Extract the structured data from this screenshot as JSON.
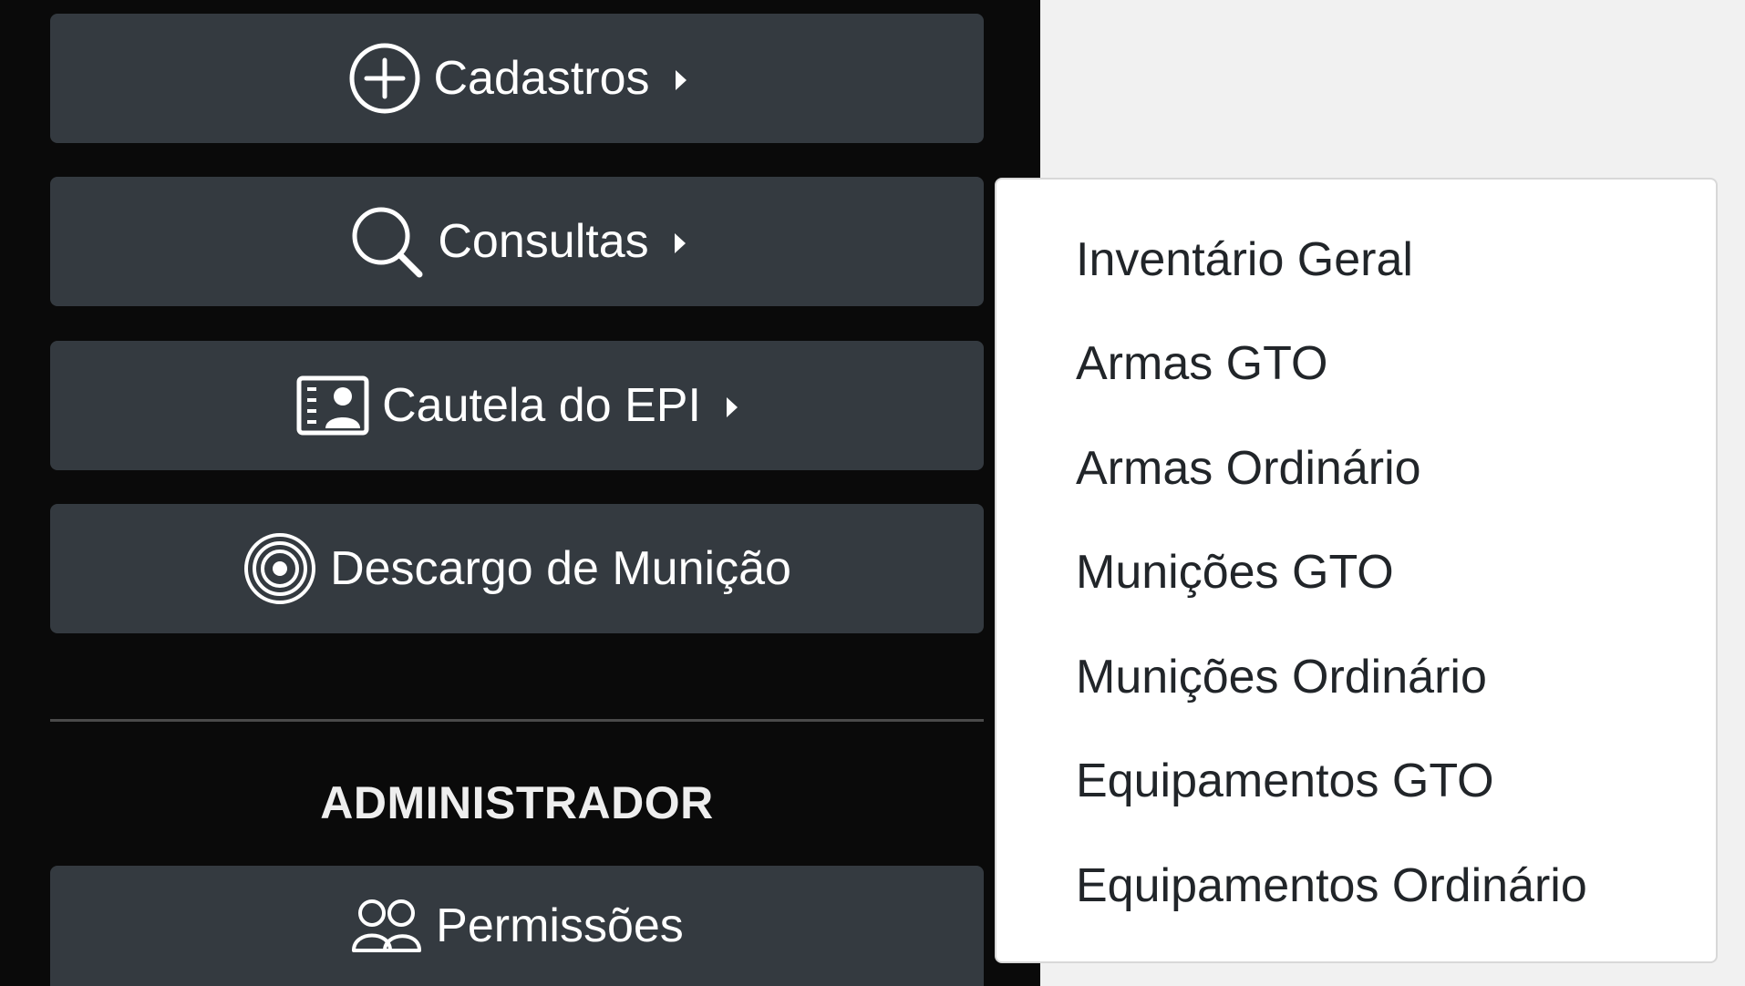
{
  "sidebar": {
    "items": [
      {
        "label": "Cadastros",
        "icon": "plus-circle-icon",
        "has_submenu": true
      },
      {
        "label": "Consultas",
        "icon": "search-icon",
        "has_submenu": true
      },
      {
        "label": "Cautela do EPI",
        "icon": "person-card-icon",
        "has_submenu": true
      },
      {
        "label": "Descargo de Munição",
        "icon": "target-icon",
        "has_submenu": false
      }
    ],
    "admin_section": {
      "title": "ADMINISTRADOR",
      "items": [
        {
          "label": "Permissões",
          "icon": "people-icon"
        }
      ]
    }
  },
  "dropdown": {
    "parent": "Consultas",
    "items": [
      {
        "label": "Inventário Geral"
      },
      {
        "label": "Armas GTO"
      },
      {
        "label": "Armas Ordinário"
      },
      {
        "label": "Munições GTO"
      },
      {
        "label": "Munições Ordinário"
      },
      {
        "label": "Equipamentos GTO"
      },
      {
        "label": "Equipamentos Ordinário"
      }
    ]
  },
  "colors": {
    "sidebar_bg": "#0a0a0a",
    "button_bg": "#343a40",
    "text_light": "#ffffff",
    "dropdown_bg": "#ffffff",
    "dropdown_text": "#212529",
    "page_bg": "#f1f1f1"
  }
}
